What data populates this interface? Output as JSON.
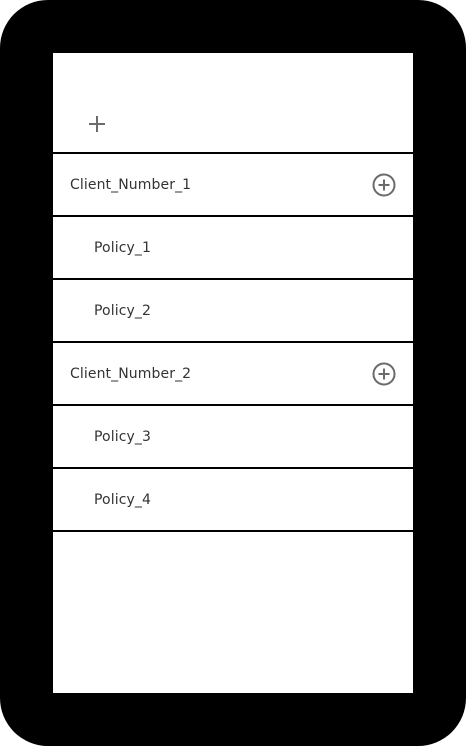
{
  "colors": {
    "frame": "#000000",
    "screen": "#ffffff",
    "text": "#333333",
    "icon": "#6b6b6b",
    "divider": "#000000"
  },
  "header": {
    "add_icon": "plus-icon"
  },
  "clients": [
    {
      "label": "Client_Number_1",
      "add_icon": "plus-circle-icon",
      "policies": [
        {
          "label": "Policy_1"
        },
        {
          "label": "Policy_2"
        }
      ]
    },
    {
      "label": "Client_Number_2",
      "add_icon": "plus-circle-icon",
      "policies": [
        {
          "label": "Policy_3"
        },
        {
          "label": "Policy_4"
        }
      ]
    }
  ]
}
